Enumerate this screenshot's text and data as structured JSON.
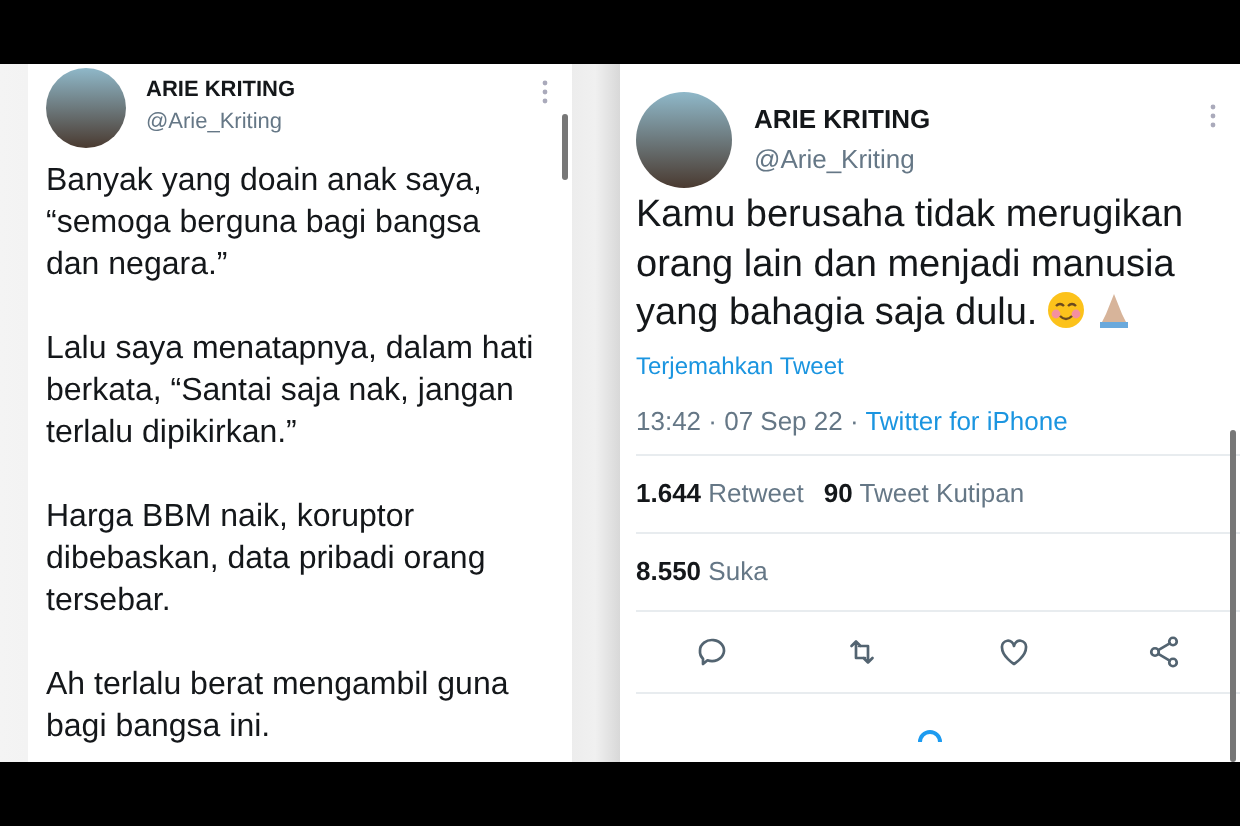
{
  "tweets": [
    {
      "name": "ARIE KRITING",
      "handle": "@Arie_Kriting",
      "paragraphs": [
        "Banyak yang doain anak saya, “semoga berguna bagi bangsa dan negara.”",
        "Lalu saya menatapnya, dalam hati berkata, “Santai saja nak, jangan terlalu dipikirkan.”",
        "Harga BBM naik, koruptor dibebaskan, data pribadi orang tersebar.",
        "Ah terlalu berat mengambil guna bagi bangsa ini."
      ]
    },
    {
      "name": "ARIE KRITING",
      "handle": "@Arie_Kriting",
      "paragraphs": [
        "Kamu berusaha tidak merugikan orang lain dan menjadi manusia yang bahagia saja dulu."
      ],
      "translate": "Terjemahkan Tweet",
      "time": "13:42 · 07 Sep 22 · ",
      "source": "Twitter for iPhone",
      "stats": [
        {
          "count": "1.644",
          "label": "Retweet"
        },
        {
          "count": "90",
          "label": "Tweet Kutipan"
        }
      ],
      "likes": {
        "count": "8.550",
        "label": "Suka"
      }
    }
  ]
}
